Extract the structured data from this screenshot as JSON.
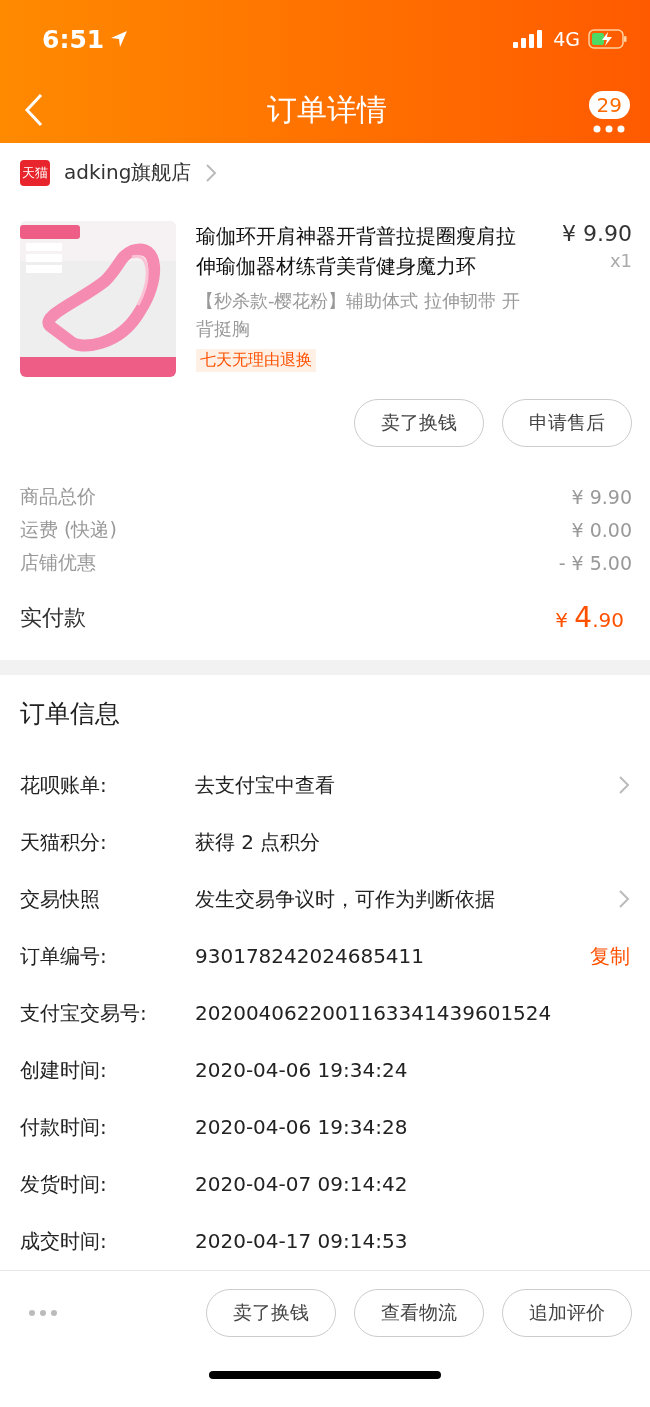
{
  "status_bar": {
    "time": "6:51",
    "network": "4G"
  },
  "nav": {
    "title": "订单详情",
    "badge": "29"
  },
  "store": {
    "logo": "天猫",
    "name": "adking旗舰店"
  },
  "product": {
    "title": "瑜伽环开肩神器开背普拉提圈瘦肩拉伸瑜伽器材练背美背健身魔力环",
    "sku": "【秒杀款-樱花粉】辅助体式 拉伸韧带 开背挺胸",
    "tag": "七天无理由退换",
    "price": "¥ 9.90",
    "quantity": "x1"
  },
  "item_actions": [
    "卖了换钱",
    "申请售后"
  ],
  "costs": [
    {
      "label": "商品总价",
      "value": "¥ 9.90"
    },
    {
      "label": "运费 (快递)",
      "value": "¥ 0.00"
    },
    {
      "label": "店铺优惠",
      "value": "- ¥ 5.00"
    }
  ],
  "total": {
    "label": "实付款",
    "symbol": "¥",
    "whole": "4",
    "fraction": ".90"
  },
  "order_info": {
    "title": "订单信息",
    "rows": [
      {
        "label": "花呗账单:",
        "value": "去支付宝中查看",
        "kind": "link"
      },
      {
        "label": "天猫积分:",
        "value": "获得 2 点积分",
        "kind": "plain"
      },
      {
        "label": "交易快照",
        "value": "发生交易争议时，可作为判断依据",
        "kind": "link"
      },
      {
        "label": "订单编号:",
        "value": "930178242024685411",
        "kind": "copy",
        "action": "复制"
      },
      {
        "label": "支付宝交易号:",
        "value": "2020040622001163341439601524",
        "kind": "plain"
      },
      {
        "label": "创建时间:",
        "value": "2020-04-06 19:34:24",
        "kind": "plain"
      },
      {
        "label": "付款时间:",
        "value": "2020-04-06 19:34:28",
        "kind": "plain"
      },
      {
        "label": "发货时间:",
        "value": "2020-04-07 09:14:42",
        "kind": "plain"
      },
      {
        "label": "成交时间:",
        "value": "2020-04-17 09:14:53",
        "kind": "plain"
      }
    ]
  },
  "bottom_actions": [
    "卖了换钱",
    "查看物流",
    "追加评价"
  ]
}
